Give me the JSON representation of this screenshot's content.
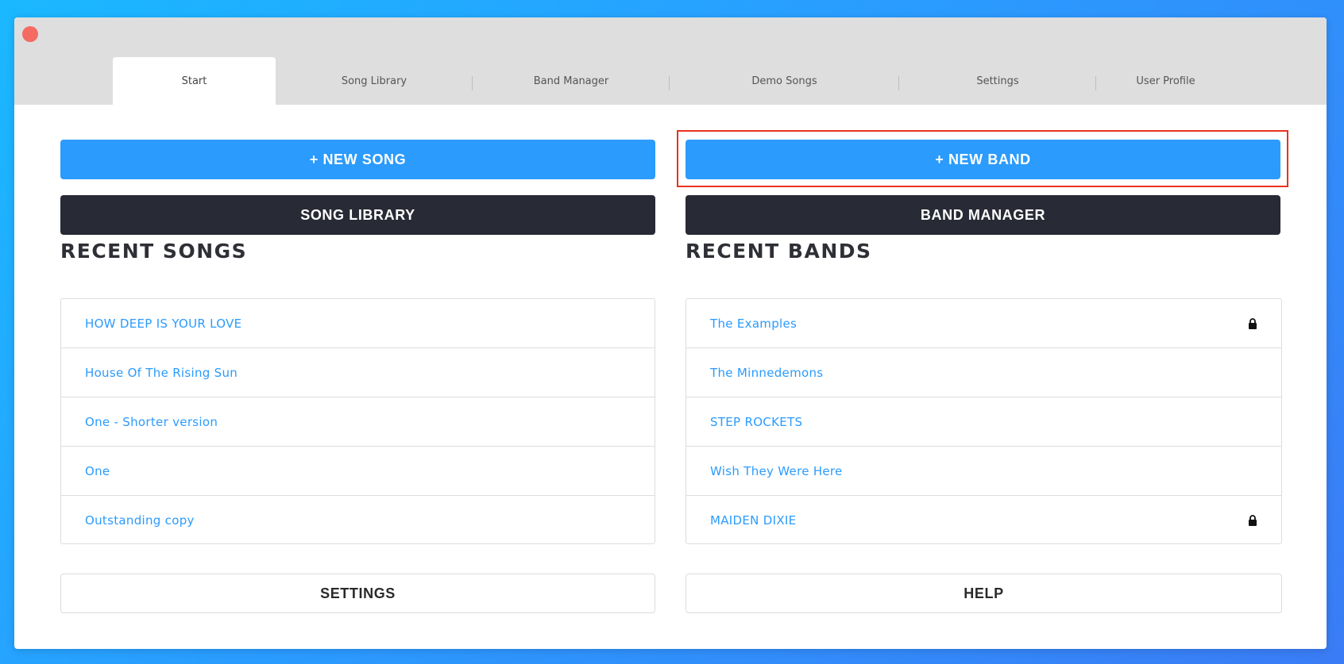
{
  "tabs": [
    {
      "label": "Start",
      "active": true
    },
    {
      "label": "Song Library",
      "active": false
    },
    {
      "label": "Band Manager",
      "active": false
    },
    {
      "label": "Demo Songs",
      "active": false
    },
    {
      "label": "Settings",
      "active": false
    },
    {
      "label": "User Profile",
      "active": false
    }
  ],
  "buttons": {
    "new_song": "+ NEW SONG",
    "new_band": "+ NEW BAND",
    "song_library": "SONG LIBRARY",
    "band_manager": "BAND MANAGER",
    "settings": "SETTINGS",
    "help": "HELP"
  },
  "recent_songs": {
    "title": "RECENT SONGS",
    "items": [
      {
        "label": "HOW DEEP IS YOUR LOVE"
      },
      {
        "label": "House Of The Rising Sun"
      },
      {
        "label": "One - Shorter version"
      },
      {
        "label": "One"
      },
      {
        "label": "Outstanding copy"
      }
    ]
  },
  "recent_bands": {
    "title": "RECENT BANDS",
    "items": [
      {
        "label": "The Examples",
        "icon": "lock-icon"
      },
      {
        "label": "The Minnedemons"
      },
      {
        "label": "STEP ROCKETS"
      },
      {
        "label": "Wish They Were Here"
      },
      {
        "label": "MAIDEN DIXIE",
        "icon": "lock-icon"
      }
    ]
  },
  "colors": {
    "accent": "#2b9bfd",
    "dark_button": "#282a35",
    "highlight": "#e8331e",
    "close_button": "#f46b63"
  }
}
